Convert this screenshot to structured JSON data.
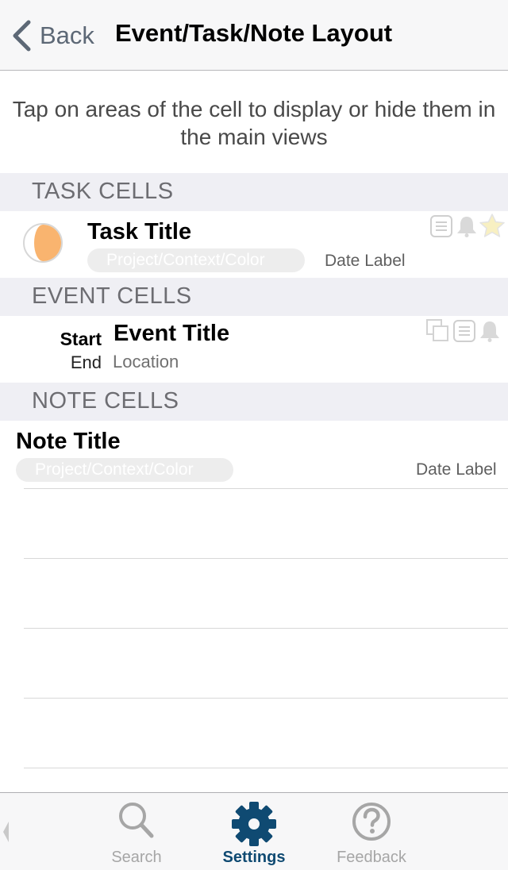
{
  "navbar": {
    "back_label": "Back",
    "title": "Event/Task/Note Layout"
  },
  "instructions": "Tap on areas of the cell to display or hide them in the main views",
  "sections": {
    "task": "TASK CELLS",
    "event": "EVENT CELLS",
    "note": "NOTE CELLS"
  },
  "task_cell": {
    "title": "Task Title",
    "pill": "Project/Context/Color",
    "date": "Date Label",
    "icons": [
      "notes-icon",
      "bell-icon",
      "star-icon"
    ]
  },
  "event_cell": {
    "start": "Start",
    "end": "End",
    "title": "Event Title",
    "location": "Location",
    "icons": [
      "copy-icon",
      "notes-icon",
      "bell-icon"
    ]
  },
  "note_cell": {
    "title": "Note Title",
    "pill": "Project/Context/Color",
    "date": "Date Label"
  },
  "tabbar": {
    "tabs": [
      {
        "label": "Search",
        "icon": "search-icon",
        "active": false
      },
      {
        "label": "Settings",
        "icon": "gear-icon",
        "active": true
      },
      {
        "label": "Feedback",
        "icon": "question-icon",
        "active": false
      }
    ]
  },
  "colors": {
    "accent": "#0f4a72",
    "progress": "#f9b46f",
    "icon_gray": "#d9d9d9",
    "star": "#f8f0c2",
    "section_bg": "#efeff4"
  }
}
